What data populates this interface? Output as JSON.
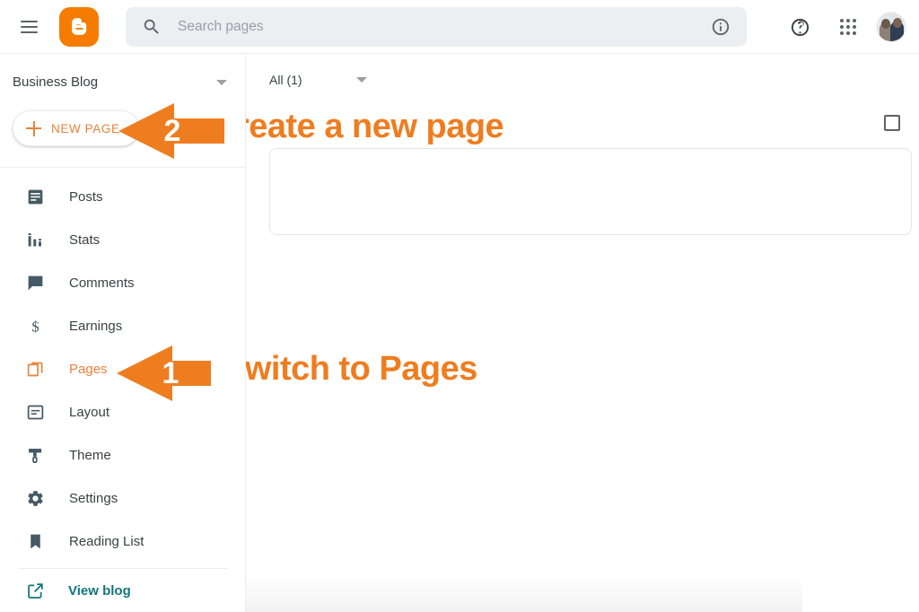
{
  "app": {
    "name": "Blogger",
    "accent_orange": "#EE7D20",
    "button_orange": "#E8833A",
    "logo_orange": "#F57C00",
    "link_teal": "#13747d",
    "icon_gray": "#455A64"
  },
  "topbar": {
    "menu_label": "Main menu",
    "logo_label": "Blogger",
    "search": {
      "placeholder": "Search pages",
      "value": "",
      "info_label": "Search options"
    },
    "help_label": "Help",
    "apps_label": "Google apps",
    "account_label": "Google Account"
  },
  "sidebar": {
    "blog_name": "Business Blog",
    "new_page_label": "NEW PAGE",
    "items": [
      {
        "label": "Posts",
        "icon": "posts-icon",
        "active": false
      },
      {
        "label": "Stats",
        "icon": "stats-icon",
        "active": false
      },
      {
        "label": "Comments",
        "icon": "comments-icon",
        "active": false
      },
      {
        "label": "Earnings",
        "icon": "earnings-icon",
        "active": false
      },
      {
        "label": "Pages",
        "icon": "pages-icon",
        "active": true
      },
      {
        "label": "Layout",
        "icon": "layout-icon",
        "active": false
      },
      {
        "label": "Theme",
        "icon": "theme-icon",
        "active": false
      },
      {
        "label": "Settings",
        "icon": "settings-icon",
        "active": false
      },
      {
        "label": "Reading List",
        "icon": "reading-list-icon",
        "active": false
      }
    ],
    "view_blog_label": "View blog"
  },
  "main": {
    "filter_label": "All (1)",
    "select_all_checked": false,
    "rows": [
      {
        "title": ""
      }
    ]
  },
  "annotations": [
    {
      "number": "1",
      "text": "Switch to Pages"
    },
    {
      "number": "2",
      "text": "Create a new page"
    }
  ]
}
